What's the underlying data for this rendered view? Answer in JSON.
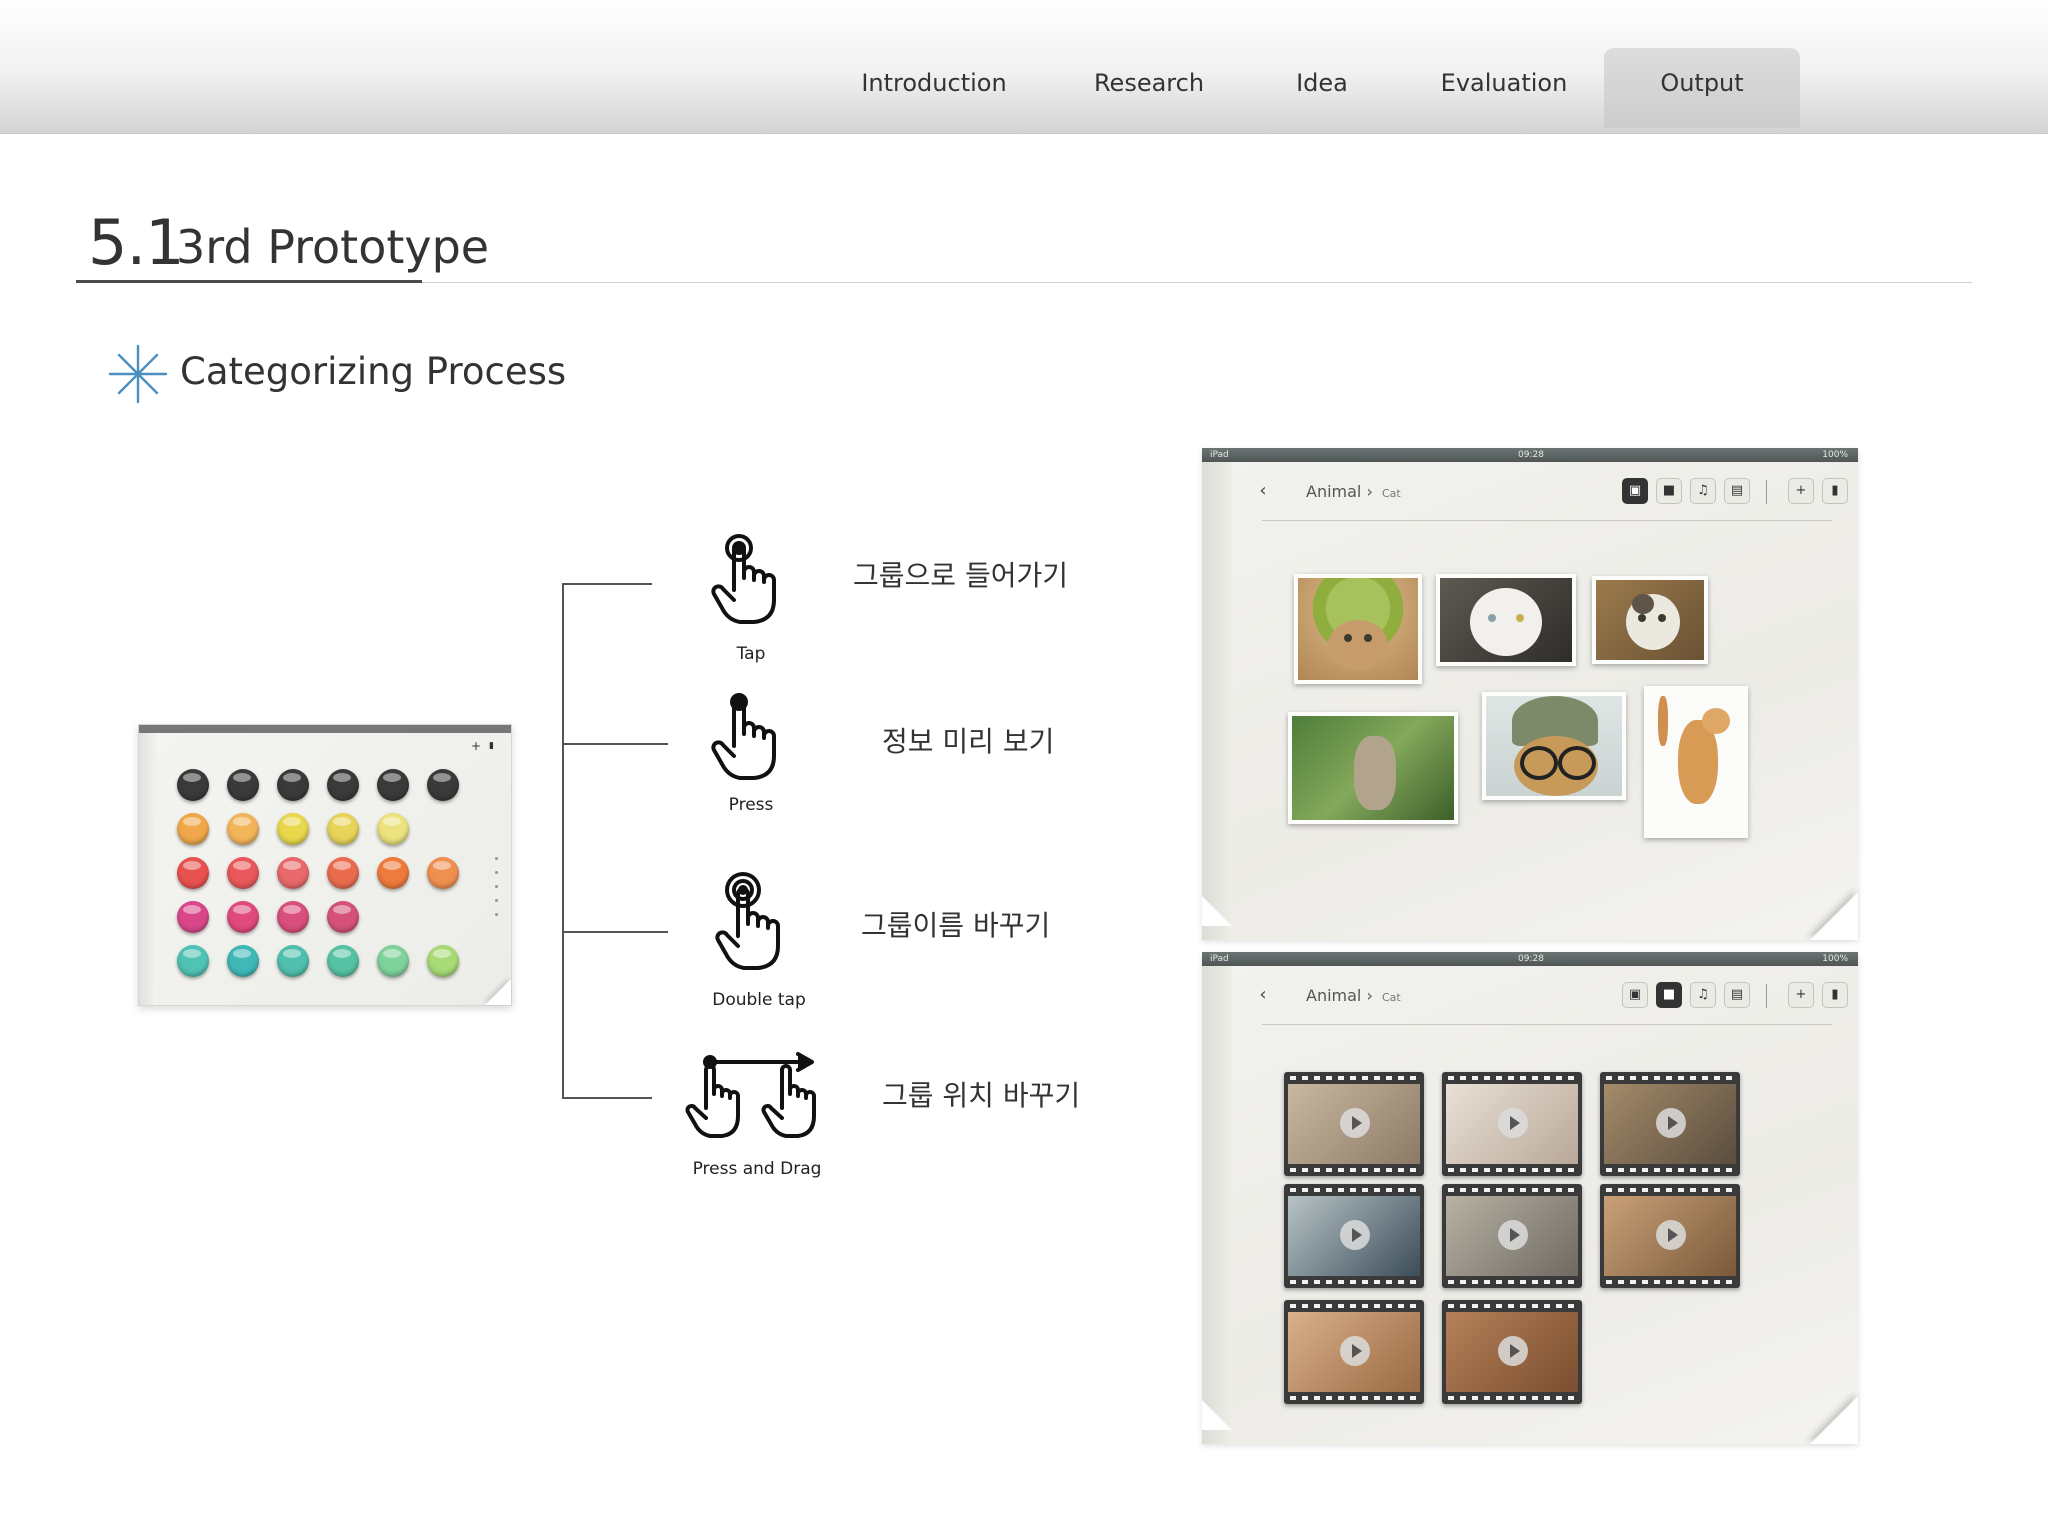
{
  "nav": {
    "items": [
      {
        "label": "Introduction"
      },
      {
        "label": "Research"
      },
      {
        "label": "Idea"
      },
      {
        "label": "Evaluation"
      },
      {
        "label": "Output",
        "active": true
      }
    ]
  },
  "section": {
    "number": "5.1",
    "title": "3rd Prototype",
    "subtitle": "Categorizing Process",
    "subtitle_icon": "asterisk-star-icon"
  },
  "gestures": [
    {
      "caption": "Tap",
      "description": "그룹으로 들어가기",
      "icon": "tap-hand-icon"
    },
    {
      "caption": "Press",
      "description": "정보 미리 보기",
      "icon": "press-hand-icon"
    },
    {
      "caption": "Double tap",
      "description": "그룹이름 바꾸기",
      "icon": "double-tap-hand-icon"
    },
    {
      "caption": "Press and Drag",
      "description": "그룹 위치 바꾸기",
      "icon": "press-drag-hands-icon"
    }
  ],
  "left_screen": {
    "toolbar": {
      "add": "+",
      "delete": "▮"
    },
    "button_rows": [
      [
        "#3a3a3a",
        "#3a3a3a",
        "#3a3a3a",
        "#3a3a3a",
        "#3a3a3a",
        "#3a3a3a"
      ],
      [
        "#f0a74a",
        "#f3b55a",
        "#e9d84c",
        "#e8d45a",
        "#ece27e"
      ],
      [
        "#e8524f",
        "#e9585a",
        "#e9686a",
        "#ea6c4e",
        "#ee7a3c",
        "#f09050"
      ],
      [
        "#d9478a",
        "#e04a7e",
        "#d94f7d",
        "#d4527a"
      ],
      [
        "#4fc3b4",
        "#3fb9b8",
        "#50bfae",
        "#56c2a4",
        "#7fd29b",
        "#a8db76"
      ]
    ]
  },
  "screens": [
    {
      "status": {
        "left": "iPad",
        "center": "09:28",
        "right": "100%"
      },
      "breadcrumb": {
        "parent": "Animal",
        "separator": "›",
        "child": "Cat"
      },
      "toolbar": {
        "back": "‹",
        "photo": "▣",
        "video": "■",
        "music": "♫",
        "doc": "▤",
        "add": "+",
        "delete": "▮"
      },
      "active_tool": "photo",
      "content": "photos"
    },
    {
      "status": {
        "left": "iPad",
        "center": "09:28",
        "right": "100%"
      },
      "breadcrumb": {
        "parent": "Animal",
        "separator": "›",
        "child": "Cat"
      },
      "toolbar": {
        "back": "‹",
        "photo": "▣",
        "video": "■",
        "music": "♫",
        "doc": "▤",
        "add": "+",
        "delete": "▮"
      },
      "active_tool": "video",
      "content": "videos"
    }
  ],
  "colors": {
    "accent_star": "#4a8fc0",
    "nav_active_bg": "#d2d2d2",
    "heading_rule": "#4b4b4b"
  }
}
